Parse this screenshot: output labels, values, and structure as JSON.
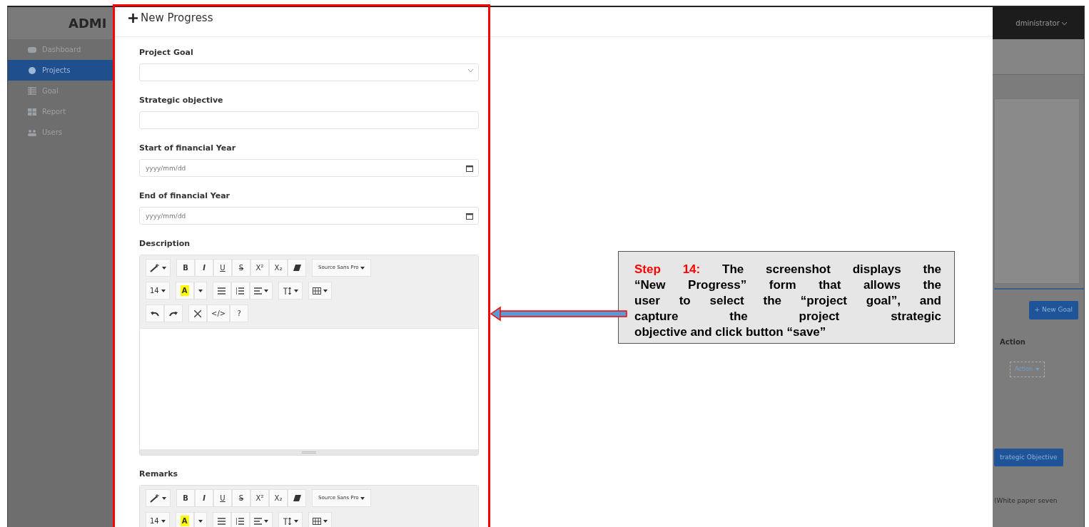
{
  "sidebar": {
    "brand": "ADMI",
    "items": [
      {
        "label": "Dashboard",
        "kind": "dashboard",
        "selected": false
      },
      {
        "label": "Projects",
        "kind": "projects",
        "selected": true
      },
      {
        "label": "Goal",
        "kind": "goal",
        "selected": false
      },
      {
        "label": "Report",
        "kind": "report",
        "selected": false
      },
      {
        "label": "Users",
        "kind": "users",
        "selected": false
      }
    ]
  },
  "backdrop": {
    "user_menu": "dministrator",
    "new_goal_button": "+ New Goal",
    "action_header": "Action",
    "action_button": "Action",
    "objective_button": "trategic Objective",
    "row_text": "(White paper seven"
  },
  "modal": {
    "title": "New Progress",
    "fields": [
      {
        "label": "Project Goal",
        "kind": "select"
      },
      {
        "label": "Strategic objective",
        "kind": "text"
      },
      {
        "label": "Start of financial Year",
        "kind": "date",
        "placeholder": "yyyy/mm/dd"
      },
      {
        "label": "End of financial Year",
        "kind": "date",
        "placeholder": "yyyy/mm/dd"
      }
    ],
    "editors": [
      {
        "label": "Description",
        "toolbar": [
          [
            [
              {
                "kind": "magic",
                "caret": true
              }
            ],
            [
              {
                "kind": "bold",
                "label": "B"
              },
              {
                "kind": "italic",
                "label": "I"
              },
              {
                "kind": "underline",
                "label": "U"
              },
              {
                "kind": "strike",
                "label": "S"
              },
              {
                "kind": "text",
                "label": "X²"
              },
              {
                "kind": "text",
                "label": "X₂"
              },
              {
                "kind": "eraser"
              }
            ],
            [
              {
                "kind": "text",
                "label": "Source Sans Pro",
                "caret": true
              }
            ]
          ],
          [
            [
              {
                "kind": "text",
                "label": "14",
                "caret": true
              }
            ],
            [
              {
                "kind": "highlight",
                "label": "A"
              },
              {
                "kind": "caret"
              }
            ],
            [
              {
                "kind": "list-ul"
              },
              {
                "kind": "list-ol"
              },
              {
                "kind": "align",
                "caret": true
              }
            ],
            [
              {
                "kind": "line-height",
                "caret": true
              }
            ],
            [
              {
                "kind": "table",
                "caret": true
              }
            ]
          ],
          [
            [
              {
                "kind": "undo"
              },
              {
                "kind": "redo"
              }
            ],
            [
              {
                "kind": "fullscreen"
              },
              {
                "kind": "text",
                "label": "</>"
              },
              {
                "kind": "text",
                "label": "?"
              }
            ]
          ]
        ]
      },
      {
        "label": "Remarks",
        "toolbar": [
          [
            [
              {
                "kind": "magic",
                "caret": true
              }
            ],
            [
              {
                "kind": "bold",
                "label": "B"
              },
              {
                "kind": "italic",
                "label": "I"
              },
              {
                "kind": "underline",
                "label": "U"
              },
              {
                "kind": "strike",
                "label": "S"
              },
              {
                "kind": "text",
                "label": "X²"
              },
              {
                "kind": "text",
                "label": "X₂"
              },
              {
                "kind": "eraser"
              }
            ],
            [
              {
                "kind": "text",
                "label": "Source Sans Pro",
                "caret": true
              }
            ]
          ],
          [
            [
              {
                "kind": "text",
                "label": "14",
                "caret": true
              }
            ],
            [
              {
                "kind": "highlight",
                "label": "A"
              },
              {
                "kind": "caret"
              }
            ],
            [
              {
                "kind": "list-ul"
              },
              {
                "kind": "list-ol"
              },
              {
                "kind": "align",
                "caret": true
              }
            ],
            [
              {
                "kind": "line-height",
                "caret": true
              }
            ],
            [
              {
                "kind": "table",
                "caret": true
              }
            ]
          ]
        ]
      }
    ]
  },
  "callout": {
    "step": "Step 14:",
    "lines": [
      "The screenshot displays the",
      "“New Progress” form that allows the",
      "user to select the “project goal”, and",
      "capture the project strategic",
      "objective and click button “save”"
    ]
  }
}
